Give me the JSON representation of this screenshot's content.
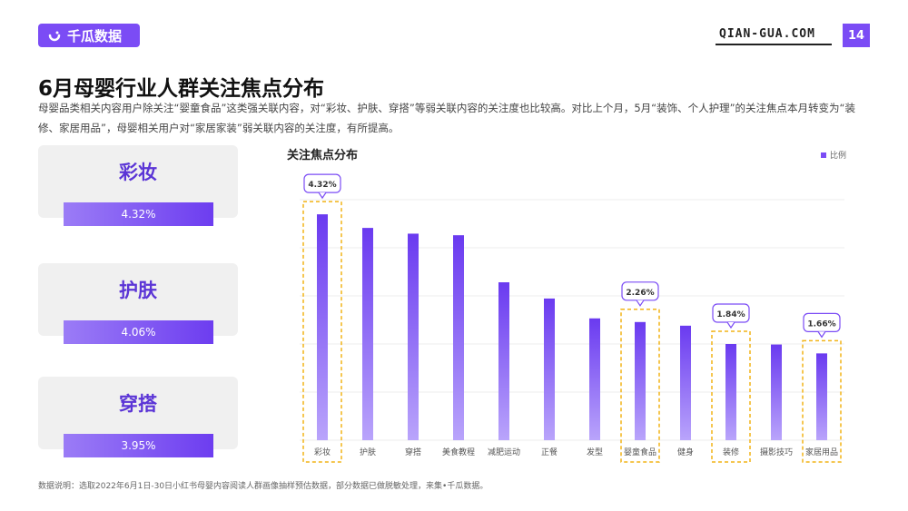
{
  "header": {
    "brand": "千瓜数据",
    "site": "QIAN-GUA.COM",
    "page_number": "14",
    "brand_color": "#7b4cf5"
  },
  "title": "6月母婴行业人群关注焦点分布",
  "description": "母婴品类相关内容用户除关注“婴童食品”这类强关联内容，对“彩妆、护肤、穿搭”等弱关联内容的关注度也比较高。对比上个月，5月“装饰、个人护理”的关注焦点本月转变为“装修、家居用品”，母婴相关用户对“家居家装”弱关联内容的关注度，有所提高。",
  "cards": [
    {
      "label": "彩妆",
      "value": "4.32%"
    },
    {
      "label": "护肤",
      "value": "4.06%"
    },
    {
      "label": "穿搭",
      "value": "3.95%"
    }
  ],
  "footnote": "数据说明：选取2022年6月1日-30日小红书母婴内容阅读人群画像抽样预估数据，部分数据已做脱敏处理，来集•千瓜数据。",
  "chart_data": {
    "type": "bar",
    "title": "关注焦点分布",
    "legend": [
      "比例"
    ],
    "legend_position": "top-right",
    "categories": [
      "彩妆",
      "护肤",
      "穿搭",
      "美食教程",
      "减肥运动",
      "正餐",
      "发型",
      "婴童食品",
      "健身",
      "装修",
      "摄影技巧",
      "家居用品"
    ],
    "series": [
      {
        "name": "比例",
        "values": [
          4.32,
          4.06,
          3.95,
          3.92,
          3.02,
          2.71,
          2.33,
          2.26,
          2.19,
          1.84,
          1.83,
          1.66
        ]
      }
    ],
    "annotations": [
      {
        "category": "彩妆",
        "label": "4.32%"
      },
      {
        "category": "婴童食品",
        "label": "2.26%"
      },
      {
        "category": "装修",
        "label": "1.84%"
      },
      {
        "category": "家居用品",
        "label": "1.66%"
      }
    ],
    "ylim": [
      0,
      4.6
    ],
    "grid": true,
    "bar_color": "#7b4cf5",
    "highlight_color": "#f2b416"
  }
}
